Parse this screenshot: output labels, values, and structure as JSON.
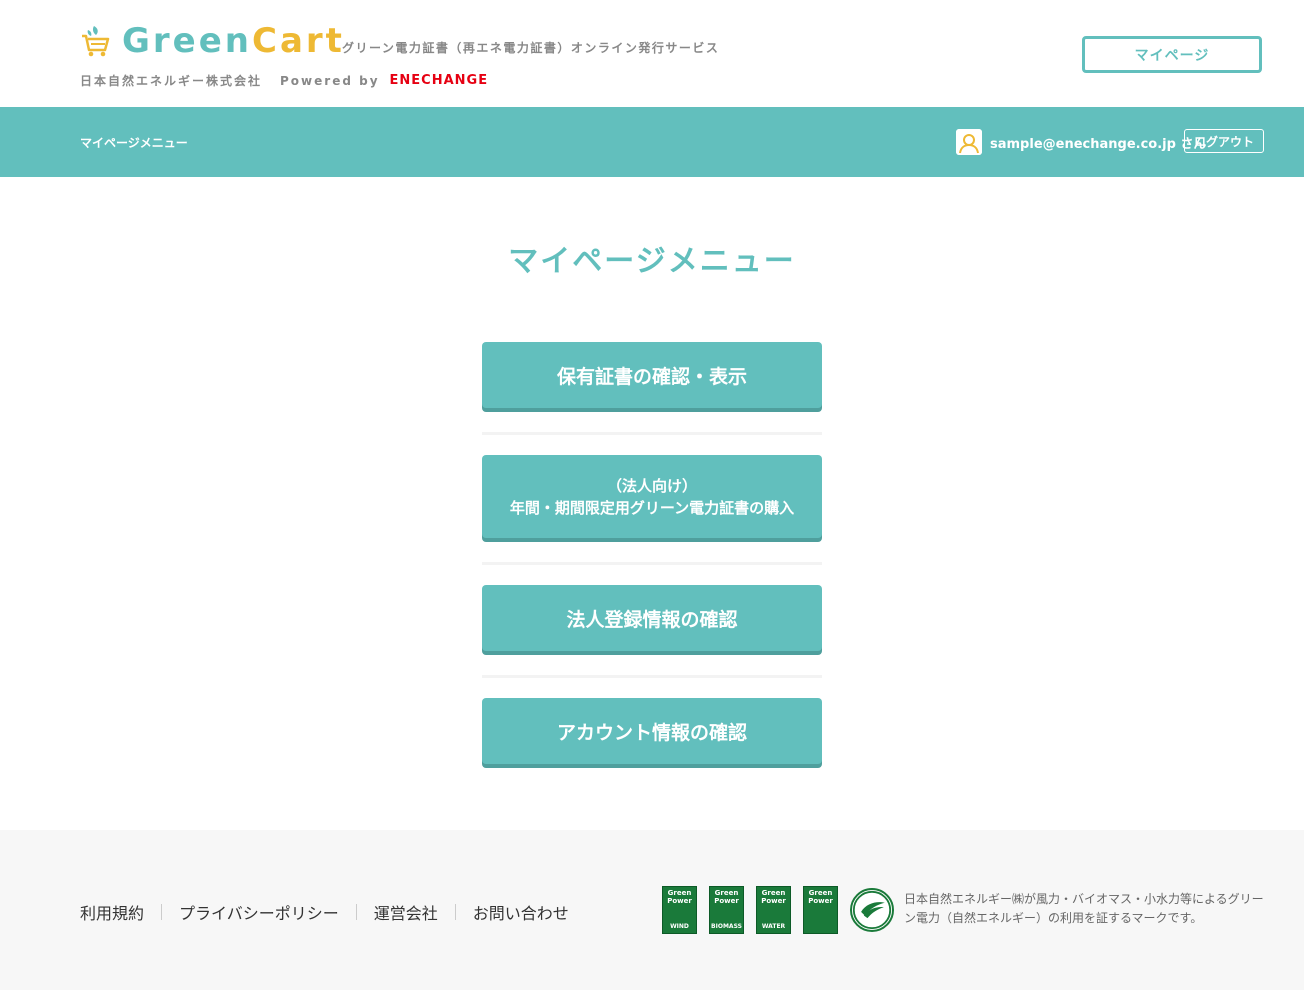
{
  "header": {
    "logo_part1": "Green",
    "logo_part2": "Cart",
    "tagline": "グリーン電力証書（再エネ電力証書）オンライン発行サービス",
    "company": "日本自然エネルギー株式会社",
    "powered_by": "Powered by",
    "powered_brand": "ENECHANGE",
    "mypage_button": "マイページ"
  },
  "bar": {
    "title": "マイページメニュー",
    "user_email": "sample@enechange.co.jp さん",
    "logout_button": "ログアウト"
  },
  "main": {
    "title": "マイページメニュー",
    "menu": [
      {
        "line1": "保有証書の確認・表示"
      },
      {
        "line1": "（法人向け）",
        "line2": "年間・期間限定用グリーン電力証書の購入"
      },
      {
        "line1": "法人登録情報の確認"
      },
      {
        "line1": "アカウント情報の確認"
      }
    ]
  },
  "footer": {
    "links": [
      "利用規約",
      "プライバシーポリシー",
      "運営会社",
      "お問い合わせ"
    ],
    "marks": [
      {
        "top": "Green Power",
        "bottom": "WIND"
      },
      {
        "top": "Green Power",
        "bottom": "BIOMASS"
      },
      {
        "top": "Green Power",
        "bottom": "WATER"
      },
      {
        "top": "Green Power",
        "bottom": ""
      }
    ],
    "round_mark": "GREEN POWER",
    "marks_description": "日本自然エネルギー㈱が風力・バイオマス・小水力等によるグリーン電力（自然エネルギー）の利用を証するマークです。"
  },
  "colors": {
    "teal": "#62bfbd",
    "yellow": "#eeb934",
    "brand_red": "#e60012"
  }
}
